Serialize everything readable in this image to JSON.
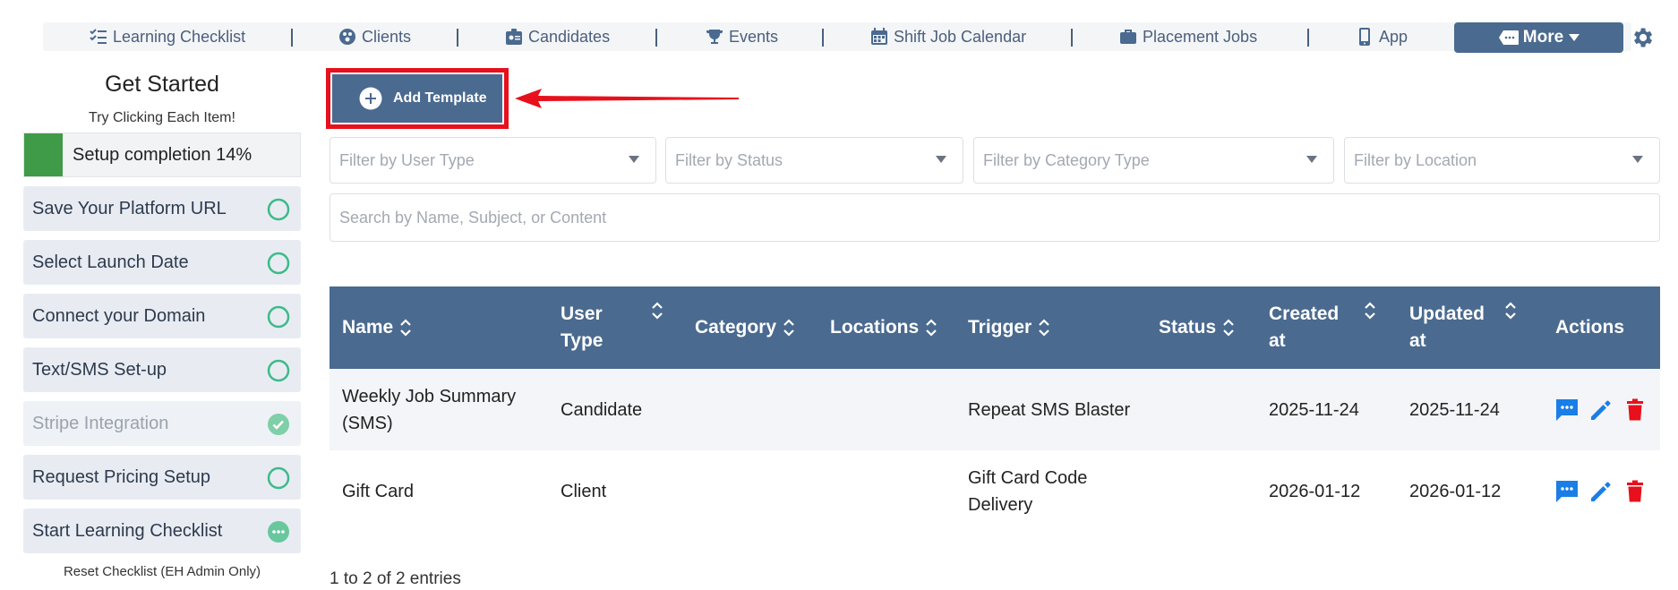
{
  "nav": {
    "items": [
      {
        "label": "Learning Checklist",
        "icon": "checklist-icon"
      },
      {
        "label": "Clients",
        "icon": "clients-icon"
      },
      {
        "label": "Candidates",
        "icon": "id-badge-icon"
      },
      {
        "label": "Events",
        "icon": "trophy-icon"
      },
      {
        "label": "Shift Job Calendar",
        "icon": "calendar-icon"
      },
      {
        "label": "Placement Jobs",
        "icon": "briefcase-icon"
      },
      {
        "label": "App",
        "icon": "mobile-icon"
      }
    ],
    "more_label": "More",
    "settings_icon": "gear-icon"
  },
  "sidebar": {
    "title": "Get Started",
    "subtitle": "Try Clicking Each Item!",
    "progress_label": "Setup completion 14%",
    "progress_percent": 14,
    "items": [
      {
        "label": "Save Your Platform URL",
        "status": "pending"
      },
      {
        "label": "Select Launch Date",
        "status": "pending"
      },
      {
        "label": "Connect your Domain",
        "status": "pending"
      },
      {
        "label": "Text/SMS Set-up",
        "status": "pending"
      },
      {
        "label": "Stripe Integration",
        "status": "done"
      },
      {
        "label": "Request Pricing Setup",
        "status": "pending"
      },
      {
        "label": "Start Learning Checklist",
        "status": "in-progress"
      }
    ],
    "reset_label": "Reset Checklist (EH Admin Only)"
  },
  "main": {
    "add_template_label": "Add Template",
    "filters": [
      {
        "placeholder": "Filter by User Type"
      },
      {
        "placeholder": "Filter by Status"
      },
      {
        "placeholder": "Filter by Category Type"
      },
      {
        "placeholder": "Filter by Location"
      }
    ],
    "search_placeholder": "Search by Name, Subject, or Content",
    "columns": [
      "Name",
      "User Type",
      "Category",
      "Locations",
      "Trigger",
      "Status",
      "Created at",
      "Updated at",
      "Actions"
    ],
    "column_lines": {
      "user_type": [
        "User",
        "Type"
      ],
      "created": [
        "Created",
        "at"
      ],
      "updated": [
        "Updated",
        "at"
      ]
    },
    "rows": [
      {
        "name_lines": [
          "Weekly Job Summary",
          "(SMS)"
        ],
        "user_type": "Candidate",
        "category": "",
        "locations": "",
        "trigger_lines": [
          "Repeat SMS Blaster"
        ],
        "status": "",
        "created": "2025-11-24",
        "updated": "2025-11-24"
      },
      {
        "name_lines": [
          "Gift Card"
        ],
        "user_type": "Client",
        "category": "",
        "locations": "",
        "trigger_lines": [
          "Gift Card Code",
          "Delivery"
        ],
        "status": "",
        "created": "2026-01-12",
        "updated": "2026-01-12"
      }
    ],
    "entries_text": "1 to 2 of 2 entries"
  },
  "colors": {
    "primary": "#4a6a8f",
    "success": "#3f9b47",
    "check_green": "#3dba8a",
    "danger": "#e8101c",
    "action_blue": "#1a7ee6"
  }
}
